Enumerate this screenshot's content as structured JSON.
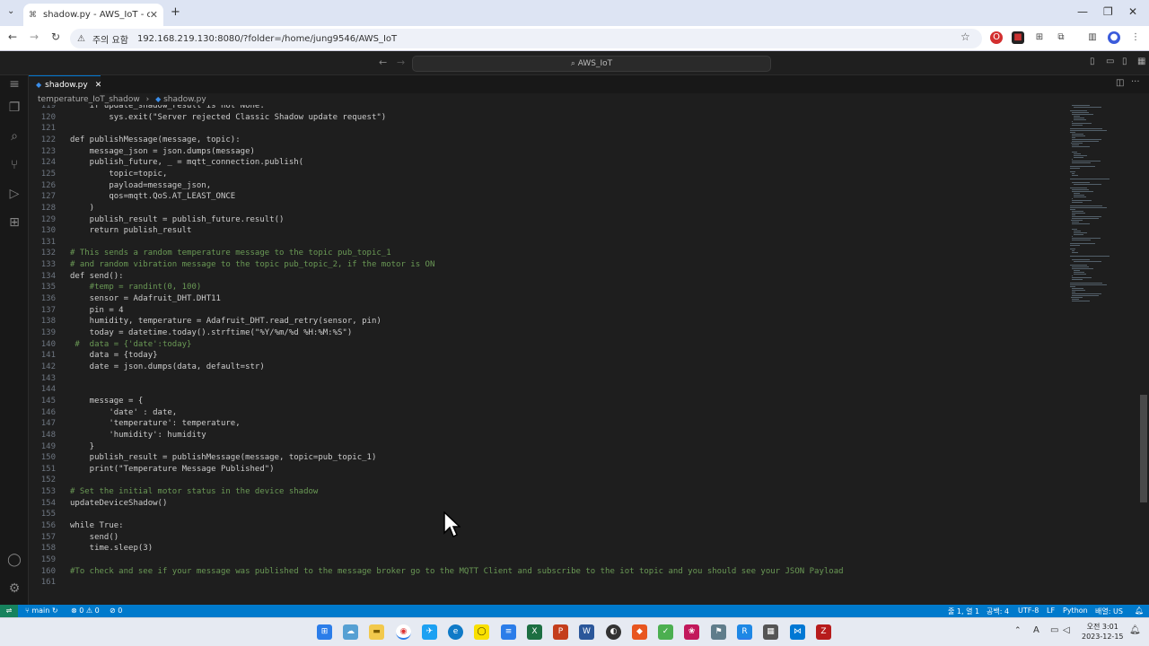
{
  "browser": {
    "tab_title": "shadow.py - AWS_IoT - code-s",
    "security_label": "주의 요함",
    "url": "192.168.219.130:8080/?folder=/home/jung9546/AWS_IoT"
  },
  "vscode": {
    "command_center": "AWS_IoT",
    "active_tab": "shadow.py",
    "breadcrumb": {
      "folder": "temperature_IoT_shadow",
      "file": "shadow.py"
    },
    "code_lines": [
      {
        "n": "119",
        "t": "    if update_shadow_result is not None:",
        "k": "code"
      },
      {
        "n": "120",
        "t": "        sys.exit(\"Server rejected Classic Shadow update request\")",
        "k": "code"
      },
      {
        "n": "121",
        "t": "",
        "k": "code"
      },
      {
        "n": "122",
        "t": "def publishMessage(message, topic):",
        "k": "code"
      },
      {
        "n": "123",
        "t": "    message_json = json.dumps(message)",
        "k": "code"
      },
      {
        "n": "124",
        "t": "    publish_future, _ = mqtt_connection.publish(",
        "k": "code"
      },
      {
        "n": "125",
        "t": "        topic=topic,",
        "k": "code"
      },
      {
        "n": "126",
        "t": "        payload=message_json,",
        "k": "code"
      },
      {
        "n": "127",
        "t": "        qos=mqtt.QoS.AT_LEAST_ONCE",
        "k": "code"
      },
      {
        "n": "128",
        "t": "    )",
        "k": "code"
      },
      {
        "n": "129",
        "t": "    publish_result = publish_future.result()",
        "k": "code"
      },
      {
        "n": "130",
        "t": "    return publish_result",
        "k": "code"
      },
      {
        "n": "131",
        "t": "",
        "k": "code"
      },
      {
        "n": "132",
        "t": "# This sends a random temperature message to the topic pub_topic_1",
        "k": "comment"
      },
      {
        "n": "133",
        "t": "# and random vibration message to the topic pub_topic_2, if the motor is ON",
        "k": "comment"
      },
      {
        "n": "134",
        "t": "def send():",
        "k": "code"
      },
      {
        "n": "135",
        "t": "    #temp = randint(0, 100)",
        "k": "comment"
      },
      {
        "n": "136",
        "t": "    sensor = Adafruit_DHT.DHT11",
        "k": "code"
      },
      {
        "n": "137",
        "t": "    pin = 4",
        "k": "code"
      },
      {
        "n": "138",
        "t": "    humidity, temperature = Adafruit_DHT.read_retry(sensor, pin)",
        "k": "code"
      },
      {
        "n": "139",
        "t": "    today = datetime.today().strftime(\"%Y/%m/%d %H:%M:%S\")",
        "k": "code"
      },
      {
        "n": "140",
        "t": " #  data = {'date':today}",
        "k": "comment"
      },
      {
        "n": "141",
        "t": "    data = {today}",
        "k": "code"
      },
      {
        "n": "142",
        "t": "    date = json.dumps(data, default=str)",
        "k": "code"
      },
      {
        "n": "143",
        "t": "",
        "k": "code"
      },
      {
        "n": "144",
        "t": "",
        "k": "code"
      },
      {
        "n": "145",
        "t": "    message = {",
        "k": "code"
      },
      {
        "n": "146",
        "t": "        'date' : date,",
        "k": "code"
      },
      {
        "n": "147",
        "t": "        'temperature': temperature,",
        "k": "code"
      },
      {
        "n": "148",
        "t": "        'humidity': humidity",
        "k": "code"
      },
      {
        "n": "149",
        "t": "    }",
        "k": "code"
      },
      {
        "n": "150",
        "t": "    publish_result = publishMessage(message, topic=pub_topic_1)",
        "k": "code"
      },
      {
        "n": "151",
        "t": "    print(\"Temperature Message Published\")",
        "k": "code"
      },
      {
        "n": "152",
        "t": "",
        "k": "code"
      },
      {
        "n": "153",
        "t": "# Set the initial motor status in the device shadow",
        "k": "comment"
      },
      {
        "n": "154",
        "t": "updateDeviceShadow()",
        "k": "code"
      },
      {
        "n": "155",
        "t": "",
        "k": "code"
      },
      {
        "n": "156",
        "t": "while True:",
        "k": "code"
      },
      {
        "n": "157",
        "t": "    send()",
        "k": "code"
      },
      {
        "n": "158",
        "t": "    time.sleep(3)",
        "k": "code"
      },
      {
        "n": "159",
        "t": "",
        "k": "code"
      },
      {
        "n": "160",
        "t": "#To check and see if your message was published to the message broker go to the MQTT Client and subscribe to the iot topic and you should see your JSON Payload",
        "k": "comment"
      },
      {
        "n": "161",
        "t": "",
        "k": "code"
      }
    ]
  },
  "statusbar": {
    "branch": "main",
    "problems": "0",
    "warnings": "0",
    "ports": "0",
    "position": "줄 1, 열 1",
    "spaces": "공백: 4",
    "encoding": "UTF-8",
    "eol": "LF",
    "language": "Python",
    "layout": "배열: US"
  },
  "taskbar": {
    "time": "오전 3:01",
    "date": "2023-12-15"
  }
}
